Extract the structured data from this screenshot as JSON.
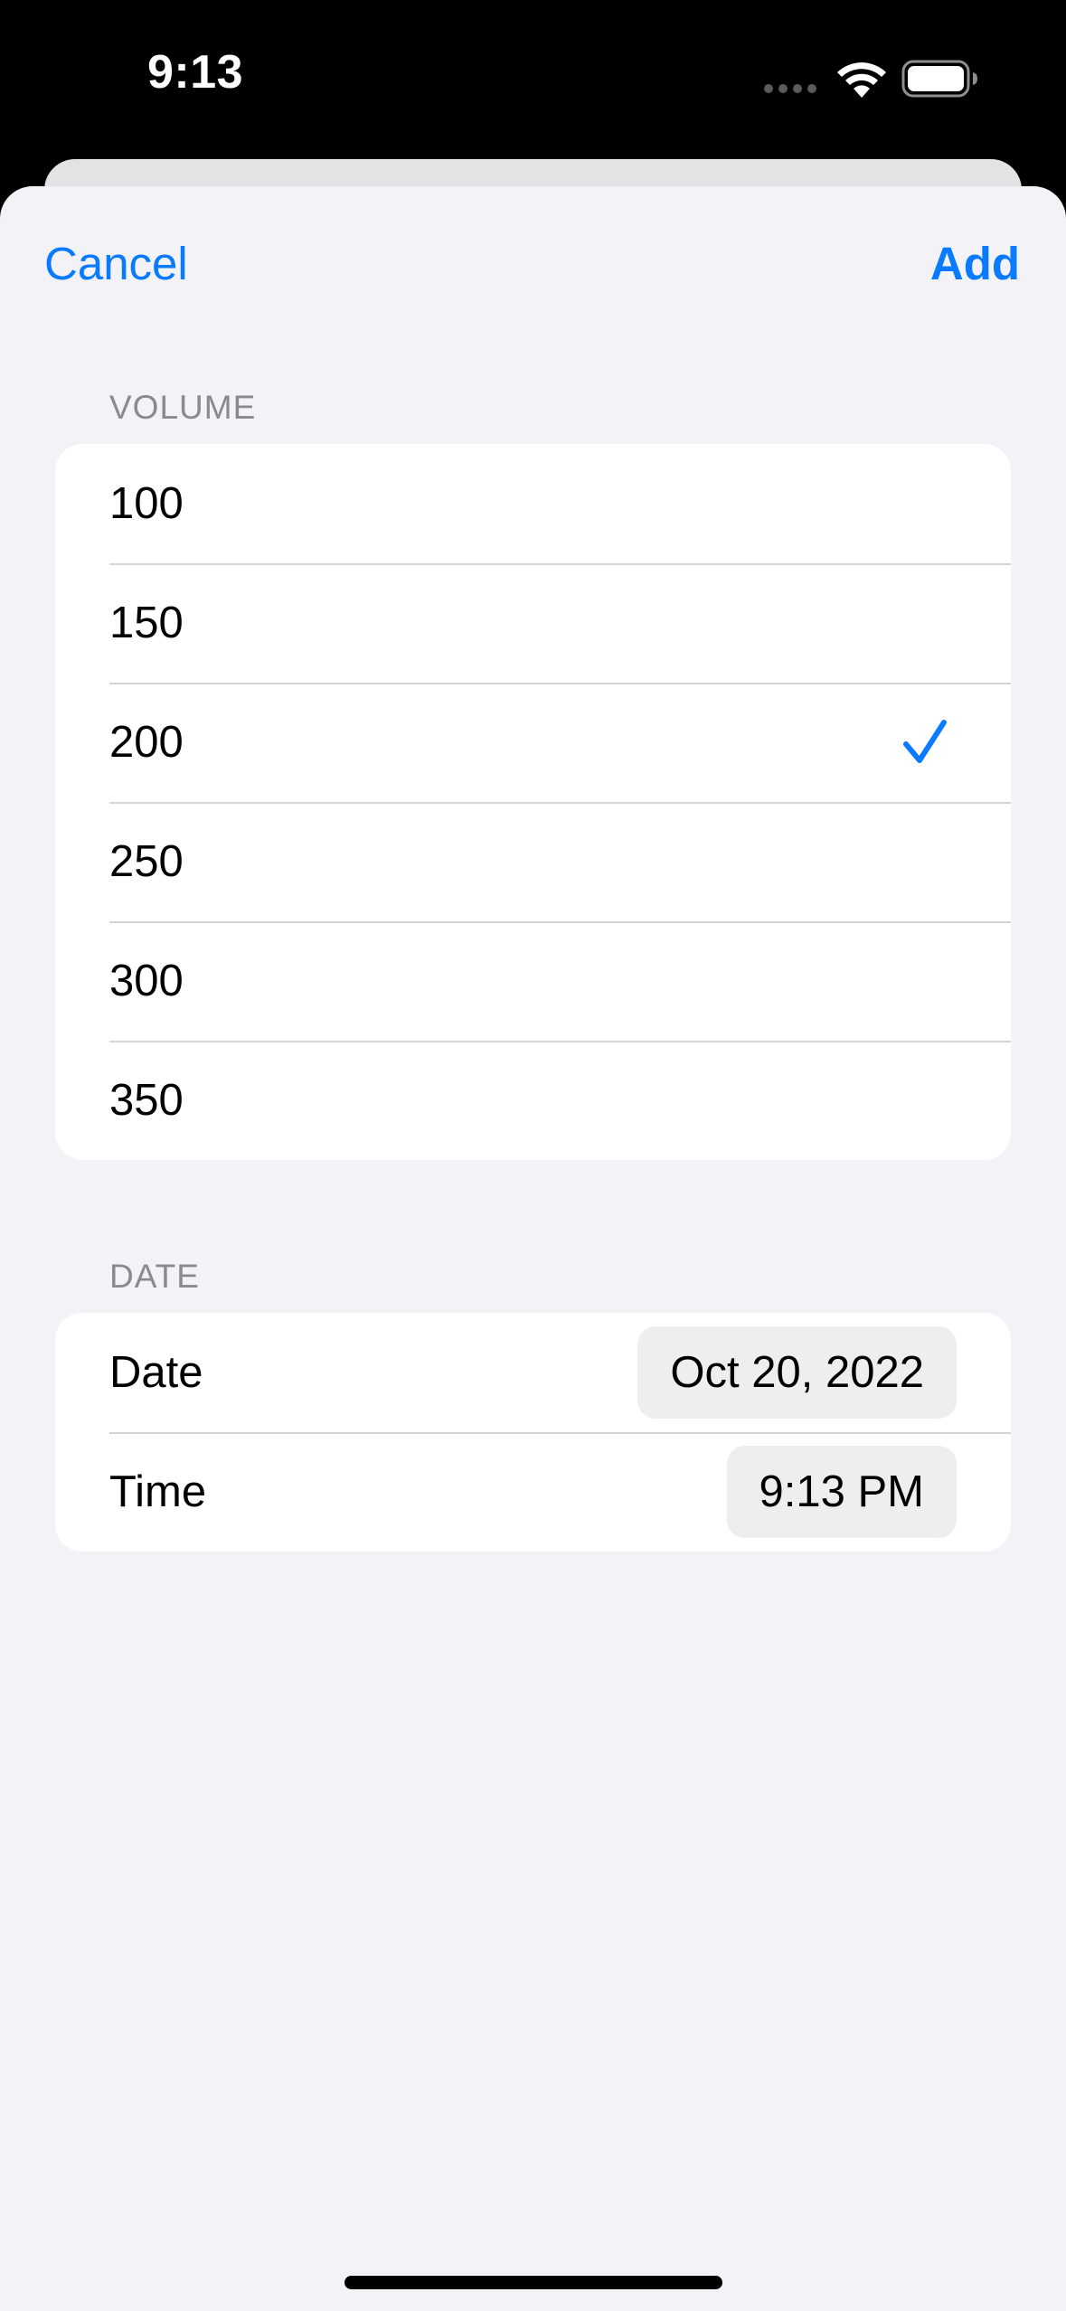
{
  "status_bar": {
    "time": "9:13"
  },
  "navigation": {
    "cancel_label": "Cancel",
    "add_label": "Add"
  },
  "volume_section": {
    "header": "VOLUME",
    "options": [
      {
        "label": "100",
        "selected": false
      },
      {
        "label": "150",
        "selected": false
      },
      {
        "label": "200",
        "selected": true
      },
      {
        "label": "250",
        "selected": false
      },
      {
        "label": "300",
        "selected": false
      },
      {
        "label": "350",
        "selected": false
      }
    ]
  },
  "date_section": {
    "header": "DATE",
    "date_label": "Date",
    "date_value": "Oct 20, 2022",
    "time_label": "Time",
    "time_value": "9:13 PM"
  },
  "colors": {
    "accent": "#0a7aff",
    "background": "#f2f2f7",
    "card": "#ffffff",
    "secondary_text": "#8a8a8e"
  },
  "icons": [
    "wifi-icon",
    "battery-icon",
    "checkmark-icon"
  ]
}
